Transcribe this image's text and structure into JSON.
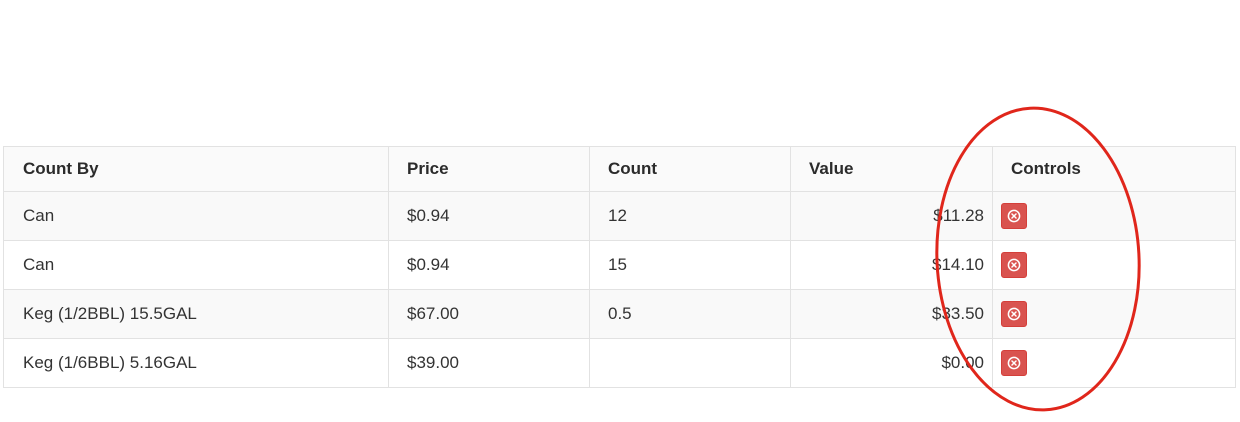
{
  "table": {
    "headers": {
      "count_by": "Count By",
      "price": "Price",
      "count": "Count",
      "value": "Value",
      "controls": "Controls"
    },
    "rows": [
      {
        "count_by": "Can",
        "price": "$0.94",
        "count": "12",
        "value": "$11.28"
      },
      {
        "count_by": "Can",
        "price": "$0.94",
        "count": "15",
        "value": "$14.10"
      },
      {
        "count_by": "Keg (1/2BBL) 15.5GAL",
        "price": "$67.00",
        "count": "0.5",
        "value": "$33.50"
      },
      {
        "count_by": "Keg (1/6BBL) 5.16GAL",
        "price": "$39.00",
        "count": "",
        "value": "$0.00"
      }
    ]
  },
  "icons": {
    "remove": "remove-circle-icon"
  },
  "colors": {
    "remove_button": "#d9534f",
    "annotation": "#e0261b",
    "row_stripe": "#f9f9f9",
    "border": "#e2e2e2"
  }
}
